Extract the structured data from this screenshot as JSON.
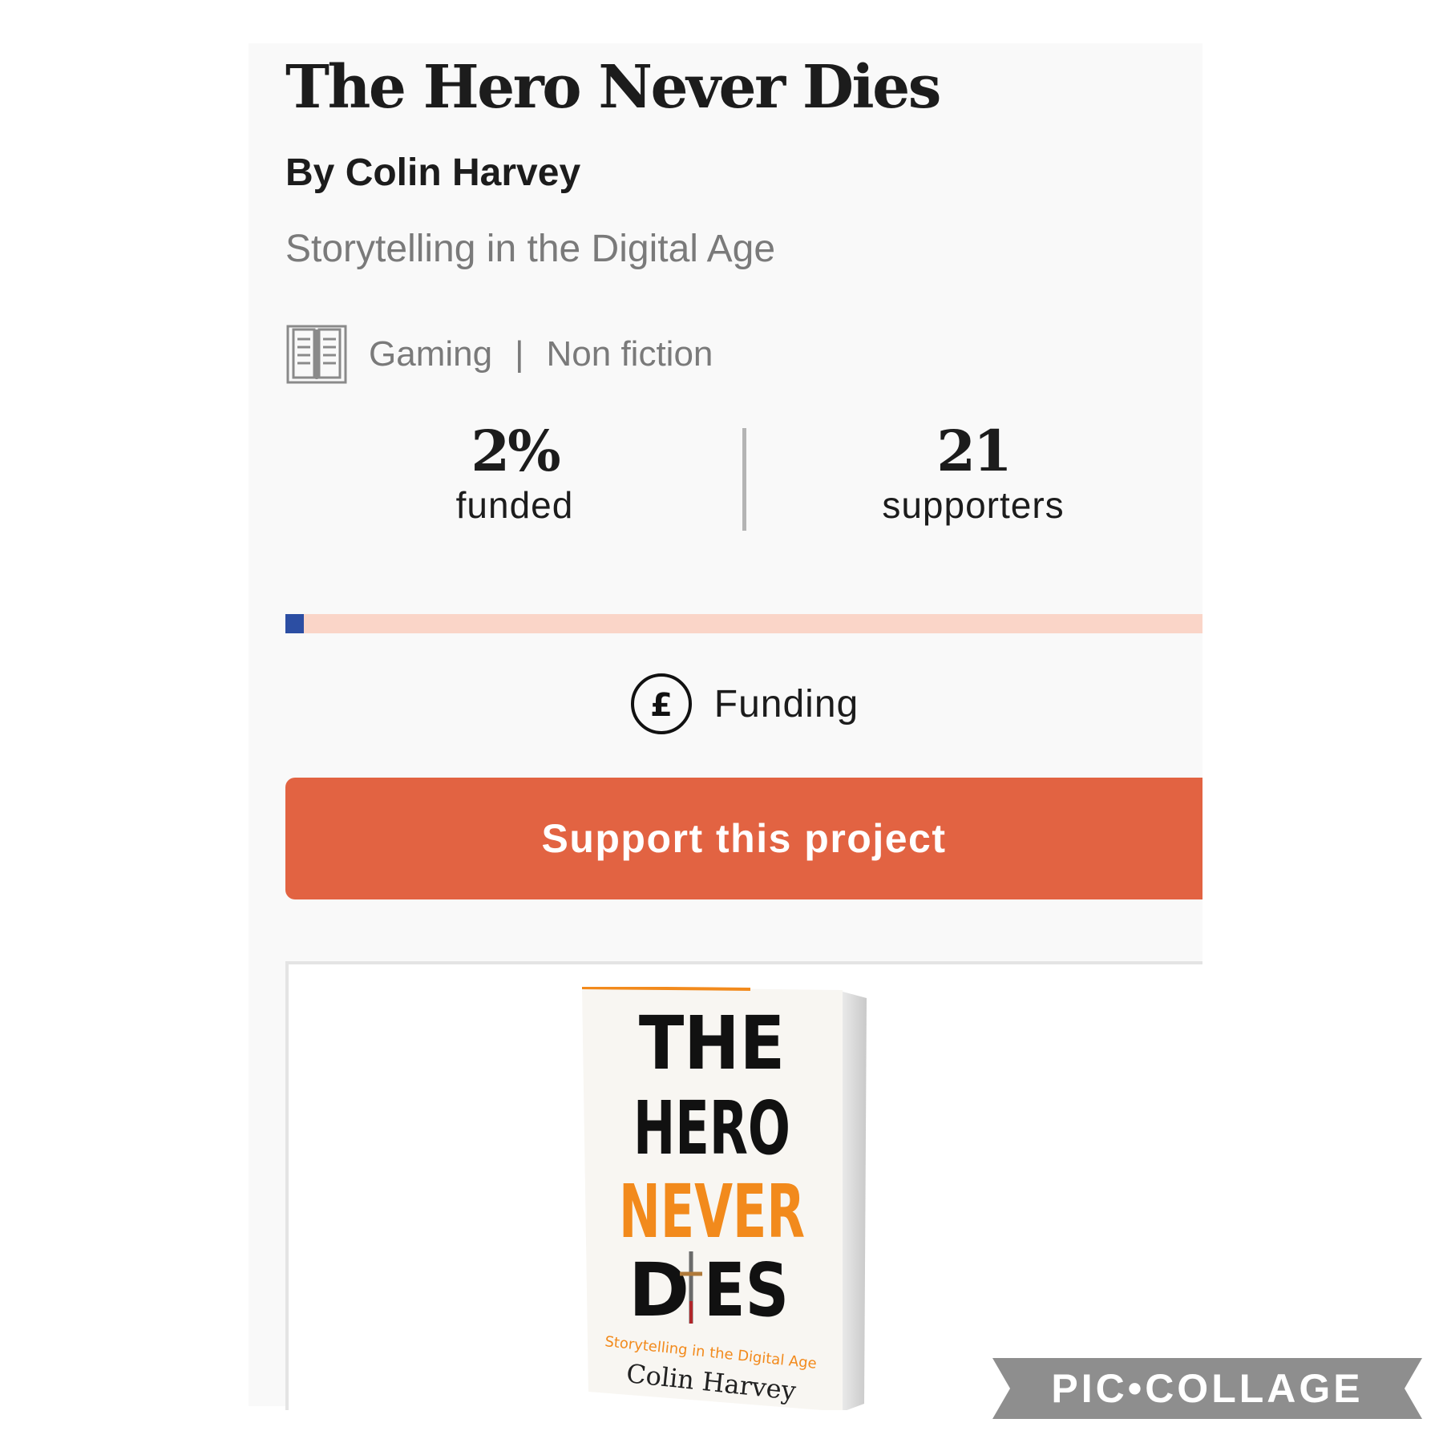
{
  "project": {
    "title": "The Hero Never Dies",
    "author": "By Colin Harvey",
    "subtitle": "Storytelling in the Digital Age",
    "genres": [
      "Gaming",
      "Non fiction"
    ],
    "genre_separator": "|",
    "icons": {
      "category": "book-open-icon",
      "funding": "pound-circle-icon"
    }
  },
  "stats": {
    "funded_value": "2%",
    "funded_label": "funded",
    "supporters_value": "21",
    "supporters_label": "supporters"
  },
  "progress": {
    "fraction": 0.02,
    "fill_color": "#2c4ea3",
    "track_color": "#fad5c8"
  },
  "funding": {
    "label": "Funding"
  },
  "cta": {
    "label": "Support this project",
    "color": "#e26342"
  },
  "cover": {
    "line1": "THE",
    "line2": "HERO",
    "line3": "NEVER",
    "line4_left": "D",
    "line4_right": "ES",
    "tagline": "Storytelling in the Digital Age",
    "author": "Colin Harvey",
    "accent": "#f28a1c"
  },
  "watermark": {
    "text": "PIC•COLLAGE"
  }
}
